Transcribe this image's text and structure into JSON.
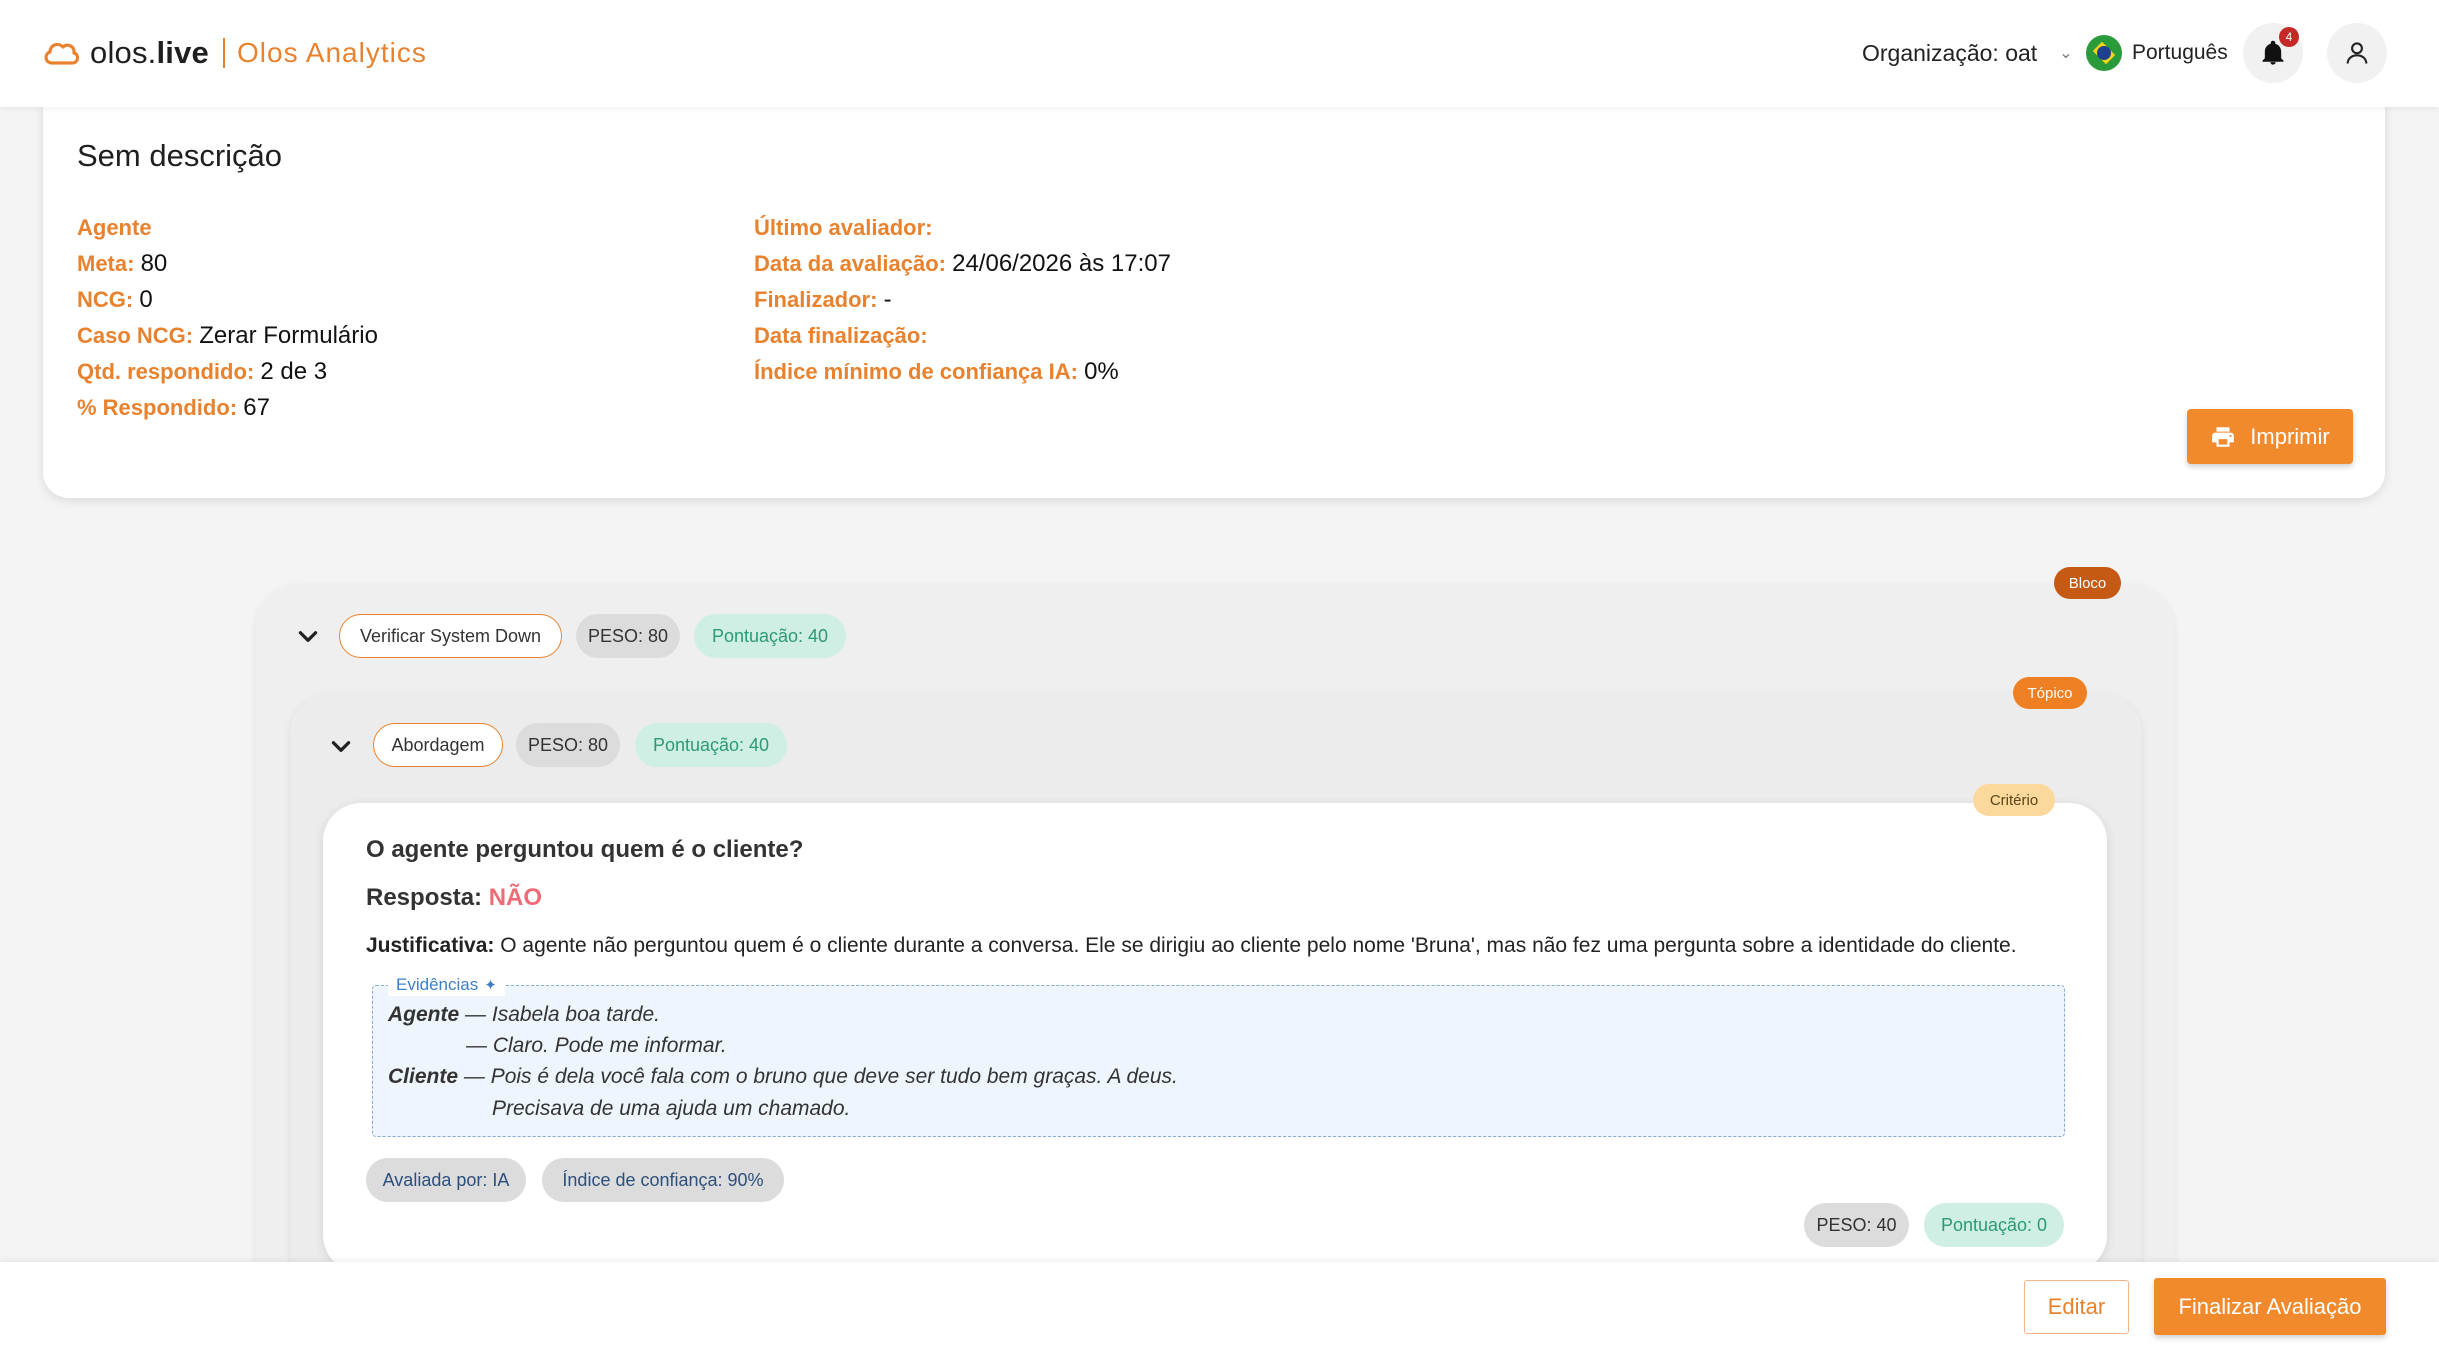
{
  "header": {
    "brand_part1": "olos.",
    "brand_part2": "live",
    "product": "Olos Analytics",
    "org_label": "Organização: oat",
    "language": "Português",
    "notifications_count": "4"
  },
  "summary": {
    "title": "Sem descrição",
    "col1": [
      {
        "key": "Agente",
        "value": ""
      },
      {
        "key": "Meta:",
        "value": "80"
      },
      {
        "key": "NCG:",
        "value": "0"
      },
      {
        "key": "Caso NCG:",
        "value": "Zerar Formulário"
      },
      {
        "key": "Qtd. respondido:",
        "value": "2 de 3"
      },
      {
        "key": "% Respondido:",
        "value": "67"
      }
    ],
    "col2": [
      {
        "key": "Último avaliador:",
        "value": ""
      },
      {
        "key": "Data da avaliação:",
        "value": "24/06/2026 às 17:07"
      },
      {
        "key": "Finalizador:",
        "value": "-"
      },
      {
        "key": "Data finalização:",
        "value": ""
      },
      {
        "key": "Índice mínimo de confiança IA:",
        "value": "0%"
      }
    ],
    "print_label": "Imprimir"
  },
  "block": {
    "tag": "Bloco",
    "name": "Verificar System Down",
    "weight": "PESO: 80",
    "score": "Pontuação: 40"
  },
  "topic": {
    "tag": "Tópico",
    "name": "Abordagem",
    "weight": "PESO: 80",
    "score": "Pontuação: 40"
  },
  "criterion": {
    "tag": "Critério",
    "question": "O agente perguntou quem é o cliente?",
    "answer_label": "Resposta:",
    "answer": "NÃO",
    "justification_label": "Justificativa:",
    "justification": "O agente não perguntou quem é o cliente durante a conversa. Ele se dirigiu ao cliente pelo nome 'Bruna', mas não fez uma pergunta sobre a identidade do cliente.",
    "evidence_title": "Evidências",
    "evidence": [
      {
        "speaker": "Agente",
        "text": "Isabela boa tarde."
      },
      {
        "speaker": "",
        "text": "Claro. Pode me informar."
      },
      {
        "speaker": "Cliente",
        "text": "Pois é dela você fala com o bruno que deve ser tudo bem graças. A deus."
      },
      {
        "speaker": "",
        "text": "Precisava de uma ajuda um chamado."
      }
    ],
    "evaluated_by": "Avaliada por: IA",
    "confidence": "Índice de confiança: 90%",
    "weight": "PESO: 40",
    "score": "Pontuação: 0"
  },
  "footer": {
    "edit_label": "Editar",
    "finalize_label": "Finalizar Avaliação"
  }
}
